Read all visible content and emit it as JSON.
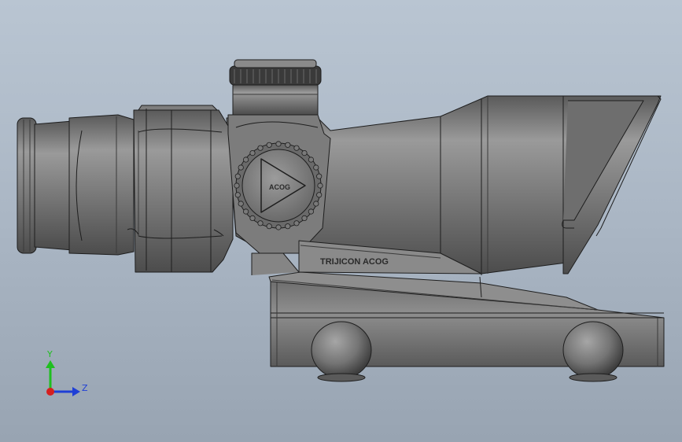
{
  "model": {
    "scope_engraving": "TRIJICON ACOG",
    "dial_label": "ACOG"
  },
  "triad": {
    "y_label": "Y",
    "z_label": "Z",
    "y_color": "#1fbf1f",
    "z_color": "#1f3fd6",
    "x_color": "#d61f1f"
  },
  "colors": {
    "background_top": "#b9c5d2",
    "background_bottom": "#98a4b2",
    "model_body": "#7b7b7b",
    "model_edge": "#1e1e1e"
  }
}
